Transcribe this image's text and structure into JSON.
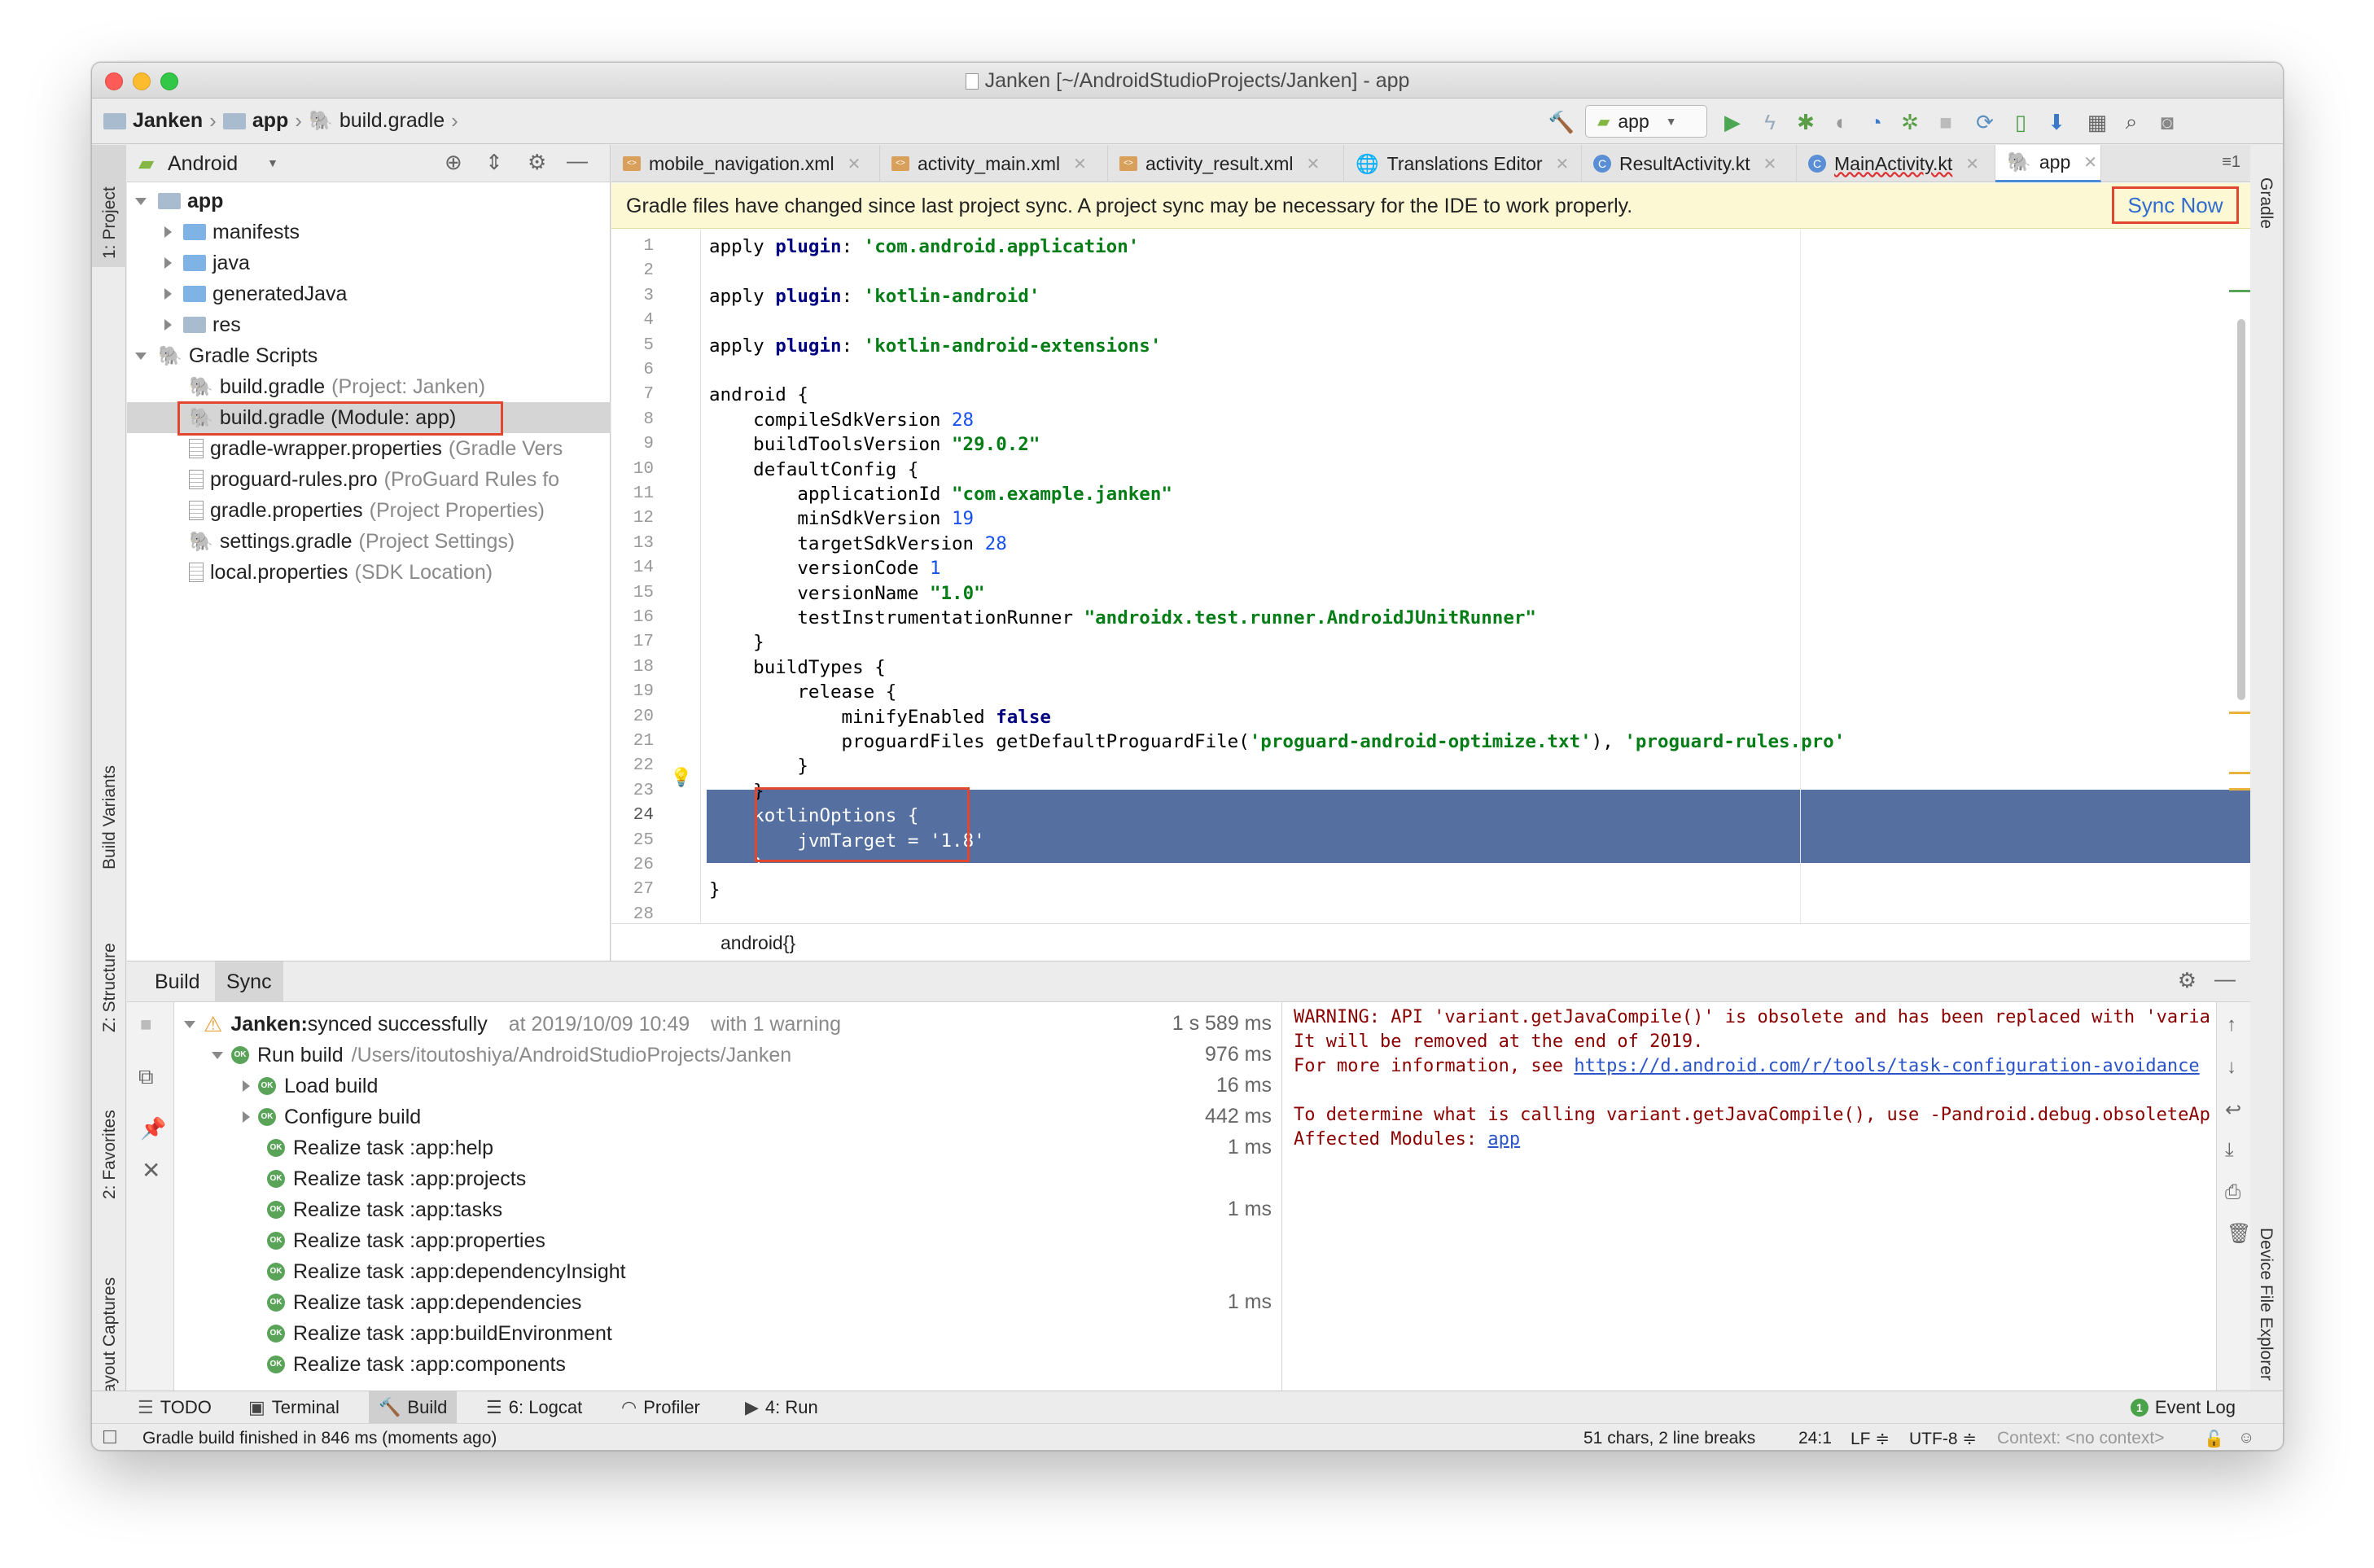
{
  "window": {
    "title": "Janken [~/AndroidStudioProjects/Janken] - app"
  },
  "navbar": {
    "crumbs": [
      "Janken",
      "app",
      "build.gradle"
    ],
    "run_config": "app"
  },
  "left_strip": {
    "project": "1: Project",
    "build_variants": "Build Variants",
    "structure": "Z: Structure",
    "favorites": "2: Favorites",
    "layout_captures": "Layout Captures"
  },
  "right_strip": {
    "gradle": "Gradle",
    "device_file_explorer": "Device File Explorer"
  },
  "project_panel": {
    "view_mode": "Android",
    "tree": [
      {
        "label": "app",
        "hint": ""
      },
      {
        "label": "manifests",
        "hint": ""
      },
      {
        "label": "java",
        "hint": ""
      },
      {
        "label": "generatedJava",
        "hint": ""
      },
      {
        "label": "res",
        "hint": ""
      },
      {
        "label": "Gradle Scripts",
        "hint": ""
      },
      {
        "label": "build.gradle",
        "hint": "(Project: Janken)"
      },
      {
        "label": "build.gradle (Module: app)",
        "hint": ""
      },
      {
        "label": "gradle-wrapper.properties",
        "hint": "(Gradle Vers"
      },
      {
        "label": "proguard-rules.pro",
        "hint": "(ProGuard Rules fo"
      },
      {
        "label": "gradle.properties",
        "hint": "(Project Properties)"
      },
      {
        "label": "settings.gradle",
        "hint": "(Project Settings)"
      },
      {
        "label": "local.properties",
        "hint": "(SDK Location)"
      }
    ]
  },
  "editor": {
    "tabs": [
      "mobile_navigation.xml",
      "activity_main.xml",
      "activity_result.xml",
      "Translations Editor",
      "ResultActivity.kt",
      "MainActivity.kt",
      "app"
    ],
    "tab_overflow": "≡1",
    "banner": {
      "message": "Gradle files have changed since last project sync. A project sync may be necessary for the IDE to work properly.",
      "action": "Sync Now"
    },
    "line_numbers": [
      "1",
      "2",
      "3",
      "4",
      "5",
      "6",
      "7",
      "8",
      "9",
      "10",
      "11",
      "12",
      "13",
      "14",
      "15",
      "16",
      "17",
      "18",
      "19",
      "20",
      "21",
      "22",
      "23",
      "24",
      "25",
      "26",
      "27",
      "28"
    ],
    "lines": [
      [
        {
          "t": "apply ",
          "c": ""
        },
        {
          "t": "plugin",
          "c": "kw"
        },
        {
          "t": ": ",
          "c": ""
        },
        {
          "t": "'com.android.application'",
          "c": "str"
        }
      ],
      [],
      [
        {
          "t": "apply ",
          "c": ""
        },
        {
          "t": "plugin",
          "c": "kw"
        },
        {
          "t": ": ",
          "c": ""
        },
        {
          "t": "'kotlin-android'",
          "c": "str"
        }
      ],
      [],
      [
        {
          "t": "apply ",
          "c": ""
        },
        {
          "t": "plugin",
          "c": "kw"
        },
        {
          "t": ": ",
          "c": ""
        },
        {
          "t": "'kotlin-android-extensions'",
          "c": "str"
        }
      ],
      [],
      [
        {
          "t": "android {",
          "c": ""
        }
      ],
      [
        {
          "t": "    compileSdkVersion ",
          "c": ""
        },
        {
          "t": "28",
          "c": "num"
        }
      ],
      [
        {
          "t": "    buildToolsVersion ",
          "c": ""
        },
        {
          "t": "\"29.0.2\"",
          "c": "str"
        }
      ],
      [
        {
          "t": "    defaultConfig {",
          "c": ""
        }
      ],
      [
        {
          "t": "        applicationId ",
          "c": ""
        },
        {
          "t": "\"com.example.janken\"",
          "c": "str"
        }
      ],
      [
        {
          "t": "        minSdkVersion ",
          "c": ""
        },
        {
          "t": "19",
          "c": "num"
        }
      ],
      [
        {
          "t": "        targetSdkVersion ",
          "c": ""
        },
        {
          "t": "28",
          "c": "num"
        }
      ],
      [
        {
          "t": "        versionCode ",
          "c": ""
        },
        {
          "t": "1",
          "c": "num"
        }
      ],
      [
        {
          "t": "        versionName ",
          "c": ""
        },
        {
          "t": "\"1.0\"",
          "c": "str"
        }
      ],
      [
        {
          "t": "        testInstrumentationRunner ",
          "c": ""
        },
        {
          "t": "\"androidx.test.runner.AndroidJUnitRunner\"",
          "c": "str"
        }
      ],
      [
        {
          "t": "    }",
          "c": ""
        }
      ],
      [
        {
          "t": "    buildTypes {",
          "c": ""
        }
      ],
      [
        {
          "t": "        release {",
          "c": ""
        }
      ],
      [
        {
          "t": "            minifyEnabled ",
          "c": ""
        },
        {
          "t": "false",
          "c": "kw"
        }
      ],
      [
        {
          "t": "            proguardFiles getDefaultProguardFile(",
          "c": ""
        },
        {
          "t": "'proguard-android-optimize.txt'",
          "c": "str"
        },
        {
          "t": "), ",
          "c": ""
        },
        {
          "t": "'proguard-rules.pro'",
          "c": "str"
        }
      ],
      [
        {
          "t": "        }",
          "c": ""
        }
      ],
      [
        {
          "t": "    }",
          "c": ""
        }
      ],
      [
        {
          "t": "    kotlinOptions {",
          "c": "selw"
        }
      ],
      [
        {
          "t": "        jvmTarget = ",
          "c": "selw"
        },
        {
          "t": "'1.8'",
          "c": "selw"
        }
      ],
      [
        {
          "t": "    }",
          "c": "selw"
        }
      ],
      [
        {
          "t": "}",
          "c": ""
        }
      ],
      []
    ],
    "breadcrumb": "android{}"
  },
  "build_panel": {
    "tabs": [
      "Build",
      "Sync"
    ],
    "rows": [
      {
        "label": "Janken:",
        "detail": " synced successfully",
        "extra": "at 2019/10/09 10:49",
        "extra2": "with 1 warning",
        "time": "1 s 589 ms"
      },
      {
        "label": "Run build",
        "detail": "/Users/itoutoshiya/AndroidStudioProjects/Janken",
        "time": "976 ms"
      },
      {
        "label": "Load build",
        "time": "16 ms"
      },
      {
        "label": "Configure build",
        "time": "442 ms"
      },
      {
        "label": "Realize task :app:help",
        "time": "1 ms"
      },
      {
        "label": "Realize task :app:projects",
        "time": ""
      },
      {
        "label": "Realize task :app:tasks",
        "time": "1 ms"
      },
      {
        "label": "Realize task :app:properties",
        "time": ""
      },
      {
        "label": "Realize task :app:dependencyInsight",
        "time": ""
      },
      {
        "label": "Realize task :app:dependencies",
        "time": "1 ms"
      },
      {
        "label": "Realize task :app:buildEnvironment",
        "time": ""
      },
      {
        "label": "Realize task :app:components",
        "time": ""
      }
    ],
    "console": {
      "line1": "WARNING: API 'variant.getJavaCompile()' is obsolete and has been replaced with 'varia",
      "line2": "It will be removed at the end of 2019.",
      "line3_prefix": "For more information, see ",
      "line3_link": "https://d.android.com/r/tools/task-configuration-avoidance",
      "line4": "To determine what is calling variant.getJavaCompile(), use -Pandroid.debug.obsoleteAp",
      "line5_prefix": "Affected Modules: ",
      "line5_link": "app"
    }
  },
  "bottom_tools": {
    "todo": "TODO",
    "terminal": "Terminal",
    "build": "Build",
    "logcat": "6: Logcat",
    "profiler": "Profiler",
    "run": "4: Run",
    "event_log": "Event Log",
    "event_count": "1"
  },
  "status": {
    "message": "Gradle build finished in 846 ms (moments ago)",
    "selection": "51 chars, 2 line breaks",
    "position": "24:1",
    "line_sep": "LF ≑",
    "encoding": "UTF-8 ≑",
    "context": "Context: <no context>"
  }
}
